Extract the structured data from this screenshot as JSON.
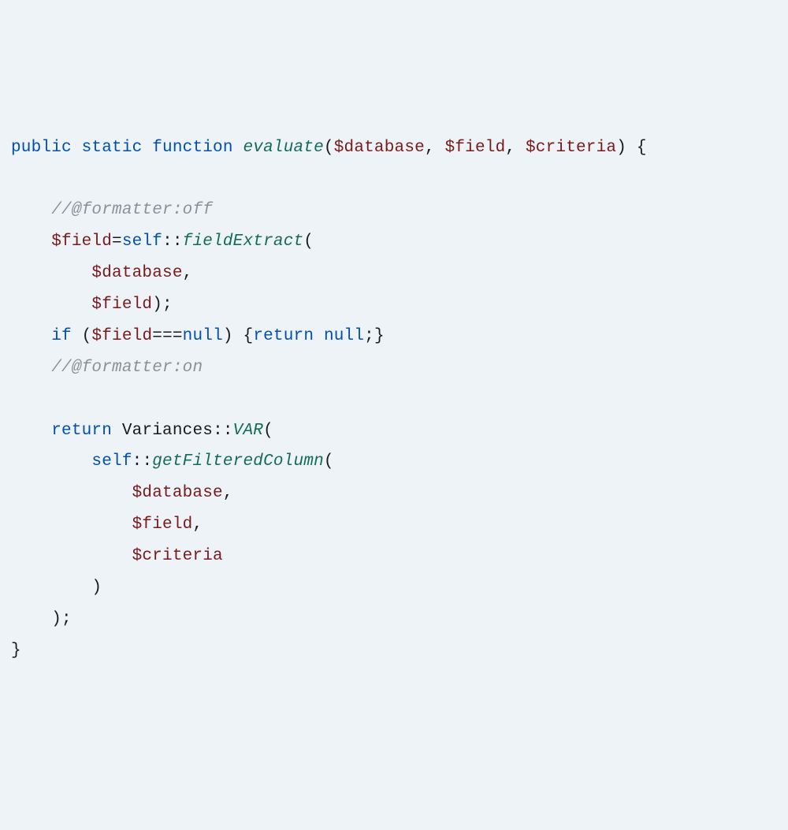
{
  "code": {
    "l1": {
      "kw1": "public",
      "kw2": "static",
      "kw3": "function",
      "fn": "evaluate",
      "p1": "$database",
      "p2": "$field",
      "p3": "$criteria"
    },
    "l2": "",
    "l3": {
      "cmt": "//@formatter:off"
    },
    "l4": {
      "var": "$field",
      "cls": "self",
      "mth": "fieldExtract"
    },
    "l5": {
      "var": "$database"
    },
    "l6": {
      "var": "$field"
    },
    "l7": {
      "kw": "if",
      "var": "$field",
      "nl": "null",
      "kw2": "return",
      "nl2": "null"
    },
    "l8": {
      "cmt": "//@formatter:on"
    },
    "l9": "",
    "l10": {
      "kw": "return",
      "cls": "Variances",
      "mth": "VAR"
    },
    "l11": {
      "cls": "self",
      "mth": "getFilteredColumn"
    },
    "l12": {
      "var": "$database"
    },
    "l13": {
      "var": "$field"
    },
    "l14": {
      "var": "$criteria"
    }
  }
}
